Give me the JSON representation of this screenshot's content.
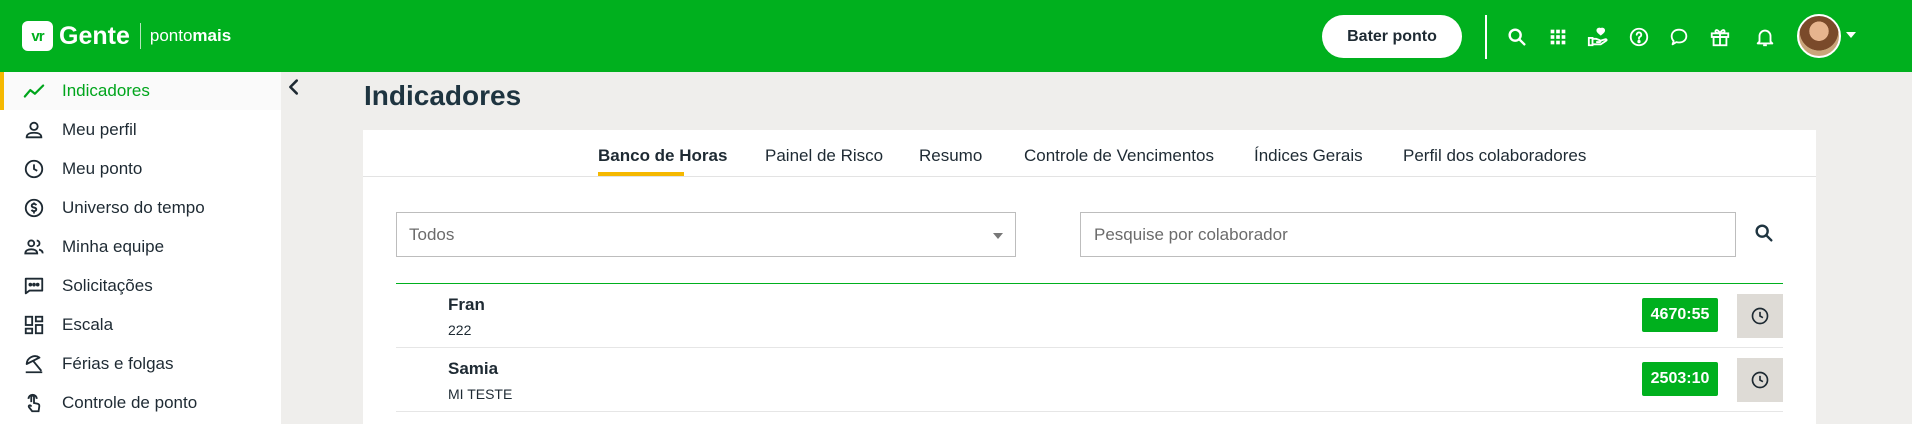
{
  "header": {
    "logo_mark": "vr",
    "logo_name": "Gente",
    "logo_sub_light": "ponto",
    "logo_sub_bold": "mais",
    "punch_button": "Bater ponto",
    "icons": [
      "search-icon",
      "apps-grid-icon",
      "hand-heart-icon",
      "help-icon",
      "chat-icon",
      "gift-icon",
      "bell-icon"
    ],
    "brand_color": "#00b01e"
  },
  "sidebar": {
    "items": [
      {
        "label": "Indicadores",
        "icon": "trend-line-icon",
        "active": true
      },
      {
        "label": "Meu perfil",
        "icon": "person-icon"
      },
      {
        "label": "Meu ponto",
        "icon": "clock-icon"
      },
      {
        "label": "Universo do tempo",
        "icon": "dollar-circle-icon"
      },
      {
        "label": "Minha equipe",
        "icon": "team-icon"
      },
      {
        "label": "Solicitações",
        "icon": "message-dots-icon"
      },
      {
        "label": "Escala",
        "icon": "dashboard-icon"
      },
      {
        "label": "Férias e folgas",
        "icon": "beach-umbrella-icon"
      },
      {
        "label": "Controle de ponto",
        "icon": "touch-hand-icon"
      }
    ]
  },
  "main": {
    "title": "Indicadores",
    "tabs": [
      {
        "label": "Banco de Horas",
        "active": true
      },
      {
        "label": "Painel de Risco"
      },
      {
        "label": "Resumo"
      },
      {
        "label": "Controle de Vencimentos"
      },
      {
        "label": "Índices Gerais"
      },
      {
        "label": "Perfil dos colaboradores"
      }
    ],
    "filter": {
      "selected": "Todos"
    },
    "search": {
      "placeholder": "Pesquise por colaborador"
    },
    "rows": [
      {
        "name": "Fran",
        "sub": "222",
        "hours": "4670:55"
      },
      {
        "name": "Samia",
        "sub": "MI TESTE",
        "hours": "2503:10"
      }
    ]
  }
}
